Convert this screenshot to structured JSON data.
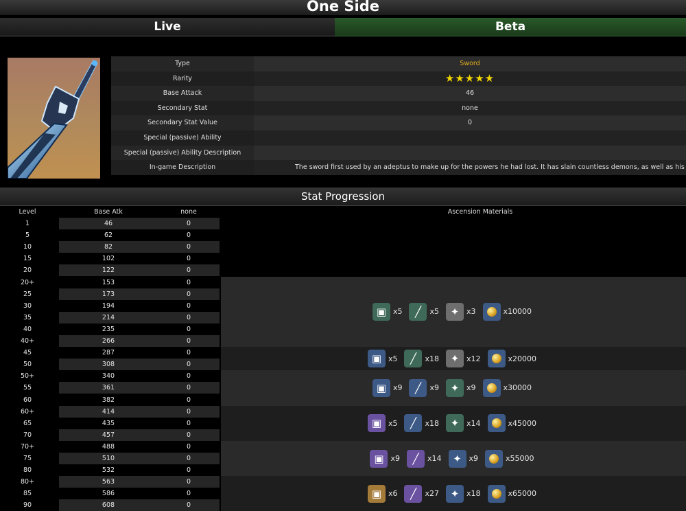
{
  "page_title": "One Side",
  "tabs": {
    "live": "Live",
    "beta": "Beta"
  },
  "info": {
    "rows": [
      {
        "label": "Type",
        "value": "Sword"
      },
      {
        "label": "Rarity",
        "value": "★★★★★"
      },
      {
        "label": "Base Attack",
        "value": "46"
      },
      {
        "label": "Secondary Stat",
        "value": "none"
      },
      {
        "label": "Secondary Stat Value",
        "value": "0"
      },
      {
        "label": "Special (passive) Ability",
        "value": ""
      },
      {
        "label": "Special (passive) Ability Description",
        "value": ""
      },
      {
        "label": "In-game Description",
        "value": "The sword first used by an adeptus to make up for the powers he had lost. It has slain countless demons, as well as his c"
      }
    ],
    "rarity_stars": 5
  },
  "stat_progression": {
    "title": "Stat Progression",
    "headers": {
      "level": "Level",
      "base_atk": "Base Atk",
      "secondary": "none",
      "ascension": "Ascension Materials"
    },
    "rows": [
      {
        "level": "1",
        "atk": "46",
        "sec": "0"
      },
      {
        "level": "5",
        "atk": "62",
        "sec": "0"
      },
      {
        "level": "10",
        "atk": "82",
        "sec": "0"
      },
      {
        "level": "15",
        "atk": "102",
        "sec": "0"
      },
      {
        "level": "20",
        "atk": "122",
        "sec": "0"
      },
      {
        "level": "20+",
        "atk": "153",
        "sec": "0"
      },
      {
        "level": "25",
        "atk": "173",
        "sec": "0"
      },
      {
        "level": "30",
        "atk": "194",
        "sec": "0"
      },
      {
        "level": "35",
        "atk": "214",
        "sec": "0"
      },
      {
        "level": "40",
        "atk": "235",
        "sec": "0"
      },
      {
        "level": "40+",
        "atk": "266",
        "sec": "0"
      },
      {
        "level": "45",
        "atk": "287",
        "sec": "0"
      },
      {
        "level": "50",
        "atk": "308",
        "sec": "0"
      },
      {
        "level": "50+",
        "atk": "340",
        "sec": "0"
      },
      {
        "level": "55",
        "atk": "361",
        "sec": "0"
      },
      {
        "level": "60",
        "atk": "382",
        "sec": "0"
      },
      {
        "level": "60+",
        "atk": "414",
        "sec": "0"
      },
      {
        "level": "65",
        "atk": "435",
        "sec": "0"
      },
      {
        "level": "70",
        "atk": "457",
        "sec": "0"
      },
      {
        "level": "70+",
        "atk": "488",
        "sec": "0"
      },
      {
        "level": "75",
        "atk": "510",
        "sec": "0"
      },
      {
        "level": "80",
        "atk": "532",
        "sec": "0"
      },
      {
        "level": "80+",
        "atk": "563",
        "sec": "0"
      },
      {
        "level": "85",
        "atk": "586",
        "sec": "0"
      },
      {
        "level": "90",
        "atk": "608",
        "sec": "0"
      }
    ],
    "ascensions": [
      {
        "items": [
          {
            "icon": "green-material-icon",
            "qty": "x5"
          },
          {
            "icon": "green-elite-drop-icon",
            "qty": "x5"
          },
          {
            "icon": "grey-common-drop-icon",
            "qty": "x3"
          },
          {
            "icon": "mora-coin-icon",
            "qty": "x10000"
          }
        ]
      },
      {
        "items": [
          {
            "icon": "blue-material-icon",
            "qty": "x5"
          },
          {
            "icon": "green-elite-drop-icon",
            "qty": "x18"
          },
          {
            "icon": "grey-common-drop-icon",
            "qty": "x12"
          },
          {
            "icon": "mora-coin-icon",
            "qty": "x20000"
          }
        ]
      },
      {
        "items": [
          {
            "icon": "blue-material-icon",
            "qty": "x9"
          },
          {
            "icon": "blue-elite-drop-icon",
            "qty": "x9"
          },
          {
            "icon": "green-common-drop-icon",
            "qty": "x9"
          },
          {
            "icon": "mora-coin-icon",
            "qty": "x30000"
          }
        ]
      },
      {
        "items": [
          {
            "icon": "purple-material-icon",
            "qty": "x5"
          },
          {
            "icon": "blue-elite-drop-icon",
            "qty": "x18"
          },
          {
            "icon": "green-common-drop-icon",
            "qty": "x14"
          },
          {
            "icon": "mora-coin-icon",
            "qty": "x45000"
          }
        ]
      },
      {
        "items": [
          {
            "icon": "purple-material-icon",
            "qty": "x9"
          },
          {
            "icon": "purple-elite-drop-icon",
            "qty": "x14"
          },
          {
            "icon": "blue-common-drop-icon",
            "qty": "x9"
          },
          {
            "icon": "mora-coin-icon",
            "qty": "x55000"
          }
        ]
      },
      {
        "items": [
          {
            "icon": "gold-material-icon",
            "qty": "x6"
          },
          {
            "icon": "purple-elite-drop-icon",
            "qty": "x27"
          },
          {
            "icon": "blue-common-drop-icon",
            "qty": "x18"
          },
          {
            "icon": "mora-coin-icon",
            "qty": "x65000"
          }
        ]
      }
    ]
  }
}
